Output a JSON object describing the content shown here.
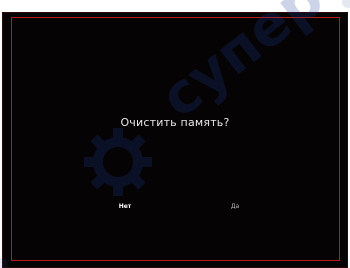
{
  "dialog": {
    "title": "Очистить память?",
    "buttons": {
      "no_label": "Нет",
      "yes_label": "Да"
    }
  },
  "watermark": {
    "text": "супер",
    "color": "#1f3fa0"
  },
  "colors": {
    "panel_background": "#050303",
    "frame_border": "#b31b1b",
    "text": "#e8e8e8"
  }
}
